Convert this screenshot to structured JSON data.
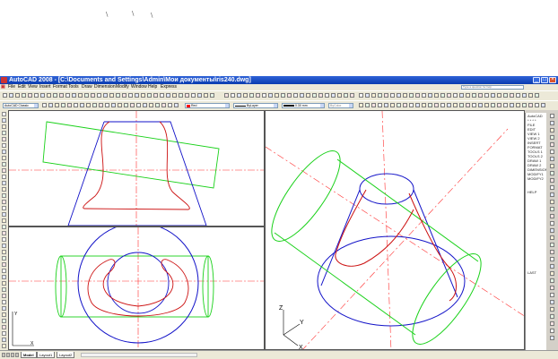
{
  "stray_marks": [
    "\\",
    "\\",
    "\\"
  ],
  "window": {
    "title": "AutoCAD 2008 - [C:\\Documents and Settings\\Admin\\Мои документы\\ris240.dwg]",
    "help_placeholder": "Type a question for help"
  },
  "menu": [
    "File",
    "Edit",
    "View",
    "Insert",
    "Format",
    "Tools",
    "Draw",
    "Dimension",
    "Modify",
    "Window",
    "Help",
    "Express"
  ],
  "toolbar": {
    "workspace": "AutoCAD Classic",
    "color": "Red",
    "linetype": "ByLayer",
    "lineweight": "0.30 mm",
    "plotstyle": "ByColor"
  },
  "side_menu": [
    "AutoCAD",
    "* * * *",
    "FILE",
    "EDIT",
    "VIEW 1",
    "VIEW 2",
    "INSERT",
    "FORMAT",
    "TOOLS 1",
    "TOOLS 2",
    "DRAW 1",
    "DRAW 2",
    "DIMENSION",
    "MODIFY1",
    "MODIFY2",
    "HELP",
    "LAST"
  ],
  "axes": {
    "x": "X",
    "y": "Y",
    "z": "Z"
  },
  "tabs": [
    "Model",
    "Layout1",
    "Layout2"
  ],
  "colors": {
    "title": "#0a3cb0",
    "green": "#19d119",
    "blue": "#1212c8",
    "red": "#cc1111",
    "axis": "#ff2020"
  }
}
